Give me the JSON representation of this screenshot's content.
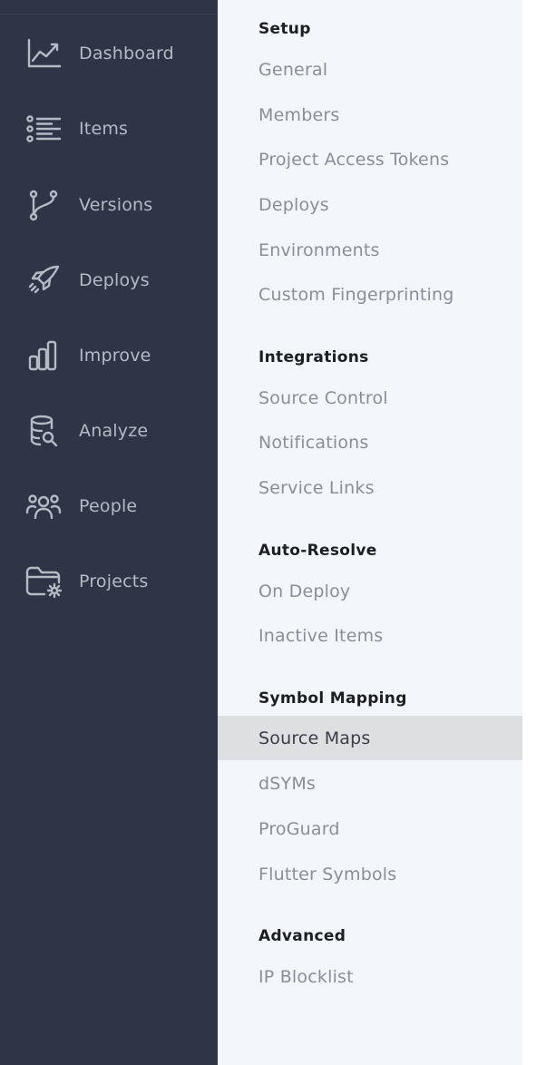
{
  "sidebar": {
    "items": [
      {
        "label": "Dashboard",
        "icon": "chart-line-icon"
      },
      {
        "label": "Items",
        "icon": "list-icon"
      },
      {
        "label": "Versions",
        "icon": "git-branch-icon"
      },
      {
        "label": "Deploys",
        "icon": "rocket-icon"
      },
      {
        "label": "Improve",
        "icon": "bar-chart-icon"
      },
      {
        "label": "Analyze",
        "icon": "database-search-icon"
      },
      {
        "label": "People",
        "icon": "users-icon"
      },
      {
        "label": "Projects",
        "icon": "folder-gear-icon"
      }
    ]
  },
  "settings": {
    "sections": [
      {
        "heading": "Setup",
        "items": [
          "General",
          "Members",
          "Project Access Tokens",
          "Deploys",
          "Environments",
          "Custom Fingerprinting"
        ]
      },
      {
        "heading": "Integrations",
        "items": [
          "Source Control",
          "Notifications",
          "Service Links"
        ]
      },
      {
        "heading": "Auto-Resolve",
        "items": [
          "On Deploy",
          "Inactive Items"
        ]
      },
      {
        "heading": "Symbol Mapping",
        "items": [
          "Source Maps",
          "dSYMs",
          "ProGuard",
          "Flutter Symbols"
        ]
      },
      {
        "heading": "Advanced",
        "items": [
          "IP Blocklist"
        ]
      }
    ],
    "active_item": "Source Maps"
  },
  "colors": {
    "sidebar_bg": "#2e3547",
    "subnav_bg": "#f3f6fb",
    "active_bg": "#dedfe1",
    "icon": "#b4bac6"
  }
}
